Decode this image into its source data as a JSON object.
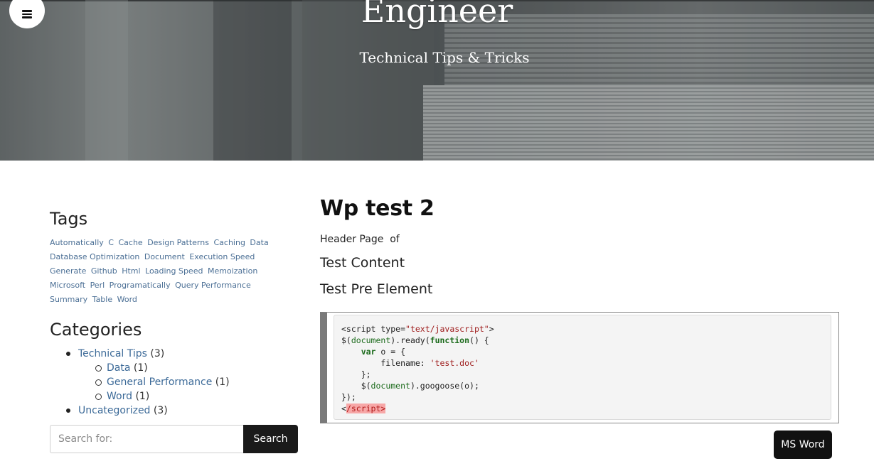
{
  "site": {
    "title": "Engineer",
    "tagline": "Technical Tips & Tricks"
  },
  "menu": {
    "icon": "hamburger-menu-icon"
  },
  "sidebar": {
    "tags_title": "Tags",
    "tags": [
      "Automatically",
      "C",
      "Cache",
      "Design Patterns",
      "Caching",
      "Data",
      "Database Optimization",
      "Document",
      "Execution Speed",
      "Generate",
      "Github",
      "Html",
      "Loading Speed",
      "Memoization",
      "Microsoft",
      "Perl",
      "Programatically",
      "Query Performance",
      "Summary",
      "Table",
      "Word"
    ],
    "categories_title": "Categories",
    "categories": [
      {
        "label": "Technical Tips",
        "count": "(3)",
        "children": [
          {
            "label": "Data",
            "count": "(1)"
          },
          {
            "label": "General Performance",
            "count": "(1)"
          },
          {
            "label": "Word",
            "count": "(1)"
          }
        ]
      },
      {
        "label": "Uncategorized",
        "count": "(3)"
      }
    ],
    "search": {
      "placeholder": "Search for:",
      "button_label": "Search"
    }
  },
  "post": {
    "title": "Wp test 2",
    "meta": "Header Page  of",
    "heading_content": "Test Content",
    "heading_pre": "Test Pre Element",
    "code": {
      "l1_tag_open": "<script type=",
      "l1_str": "\"text/javascript\"",
      "l1_end": ">",
      "l2_a": "$(",
      "l2_doc": "document",
      "l2_b": ").ready(",
      "l2_fn": "function",
      "l2_c": "() {",
      "l3_indent": "    ",
      "l3_var": "var",
      "l3_rest": " o = {",
      "l4_key": "        filename: ",
      "l4_val": "'test.doc'",
      "l5": "    };",
      "l6_a": "    $(",
      "l6_doc": "document",
      "l6_b": ").googoose(o);",
      "l7": "});",
      "l8_lt": "<",
      "l8_err": "/script>"
    },
    "button_label": "MS Word"
  }
}
